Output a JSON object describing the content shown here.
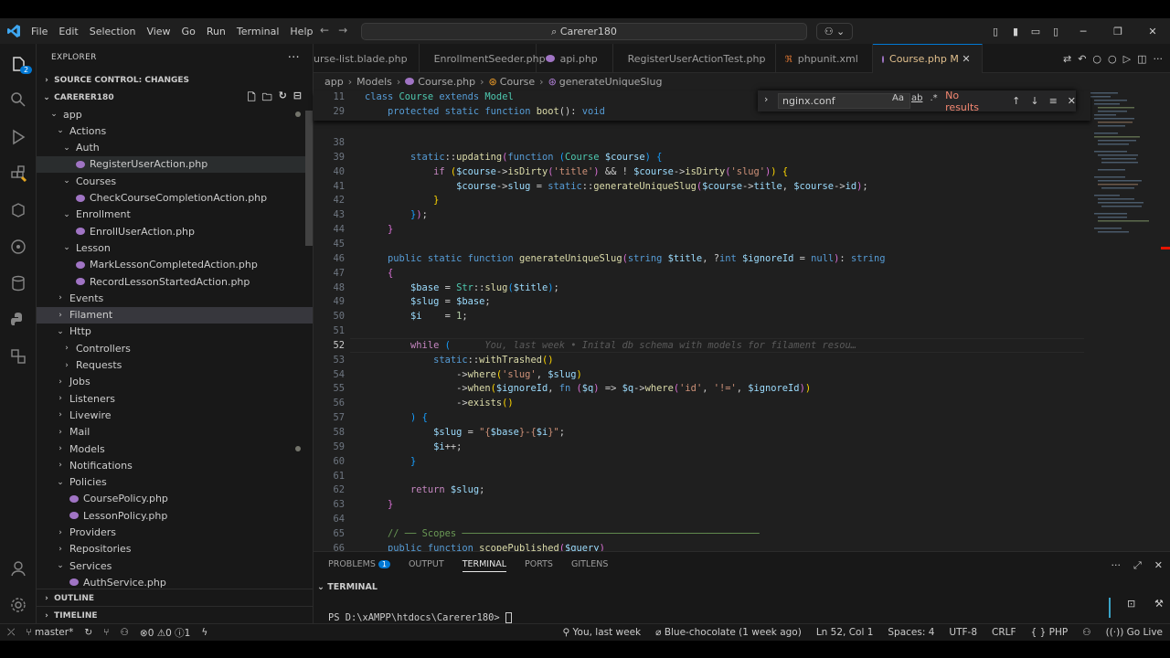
{
  "titlebar": {
    "menu": [
      "File",
      "Edit",
      "Selection",
      "View",
      "Go",
      "Run",
      "Terminal",
      "Help"
    ],
    "search": "Carerer180"
  },
  "activity": {
    "scm_badge": "2"
  },
  "explorer": {
    "header": "EXPLORER",
    "scm_section": "SOURCE CONTROL: CHANGES",
    "project": "CARERER180",
    "tree": [
      {
        "label": "app",
        "depth": 0,
        "type": "folder",
        "open": true,
        "dot": true
      },
      {
        "label": "Actions",
        "depth": 1,
        "type": "folder",
        "open": true
      },
      {
        "label": "Auth",
        "depth": 2,
        "type": "folder",
        "open": true
      },
      {
        "label": "RegisterUserAction.php",
        "depth": 3,
        "type": "file",
        "hover": true
      },
      {
        "label": "Courses",
        "depth": 2,
        "type": "folder",
        "open": true
      },
      {
        "label": "CheckCourseCompletionAction.php",
        "depth": 3,
        "type": "file"
      },
      {
        "label": "Enrollment",
        "depth": 2,
        "type": "folder",
        "open": true
      },
      {
        "label": "EnrollUserAction.php",
        "depth": 3,
        "type": "file"
      },
      {
        "label": "Lesson",
        "depth": 2,
        "type": "folder",
        "open": true
      },
      {
        "label": "MarkLessonCompletedAction.php",
        "depth": 3,
        "type": "file"
      },
      {
        "label": "RecordLessonStartedAction.php",
        "depth": 3,
        "type": "file"
      },
      {
        "label": "Events",
        "depth": 1,
        "type": "folder",
        "open": false
      },
      {
        "label": "Filament",
        "depth": 1,
        "type": "folder",
        "open": false,
        "sel": true
      },
      {
        "label": "Http",
        "depth": 1,
        "type": "folder",
        "open": true
      },
      {
        "label": "Controllers",
        "depth": 2,
        "type": "folder",
        "open": false
      },
      {
        "label": "Requests",
        "depth": 2,
        "type": "folder",
        "open": false
      },
      {
        "label": "Jobs",
        "depth": 1,
        "type": "folder",
        "open": false
      },
      {
        "label": "Listeners",
        "depth": 1,
        "type": "folder",
        "open": false
      },
      {
        "label": "Livewire",
        "depth": 1,
        "type": "folder",
        "open": false
      },
      {
        "label": "Mail",
        "depth": 1,
        "type": "folder",
        "open": false
      },
      {
        "label": "Models",
        "depth": 1,
        "type": "folder",
        "open": false,
        "dot": true
      },
      {
        "label": "Notifications",
        "depth": 1,
        "type": "folder",
        "open": false
      },
      {
        "label": "Policies",
        "depth": 1,
        "type": "folder",
        "open": true
      },
      {
        "label": "CoursePolicy.php",
        "depth": 2,
        "type": "file"
      },
      {
        "label": "LessonPolicy.php",
        "depth": 2,
        "type": "file"
      },
      {
        "label": "Providers",
        "depth": 1,
        "type": "folder",
        "open": false
      },
      {
        "label": "Repositories",
        "depth": 1,
        "type": "folder",
        "open": false
      },
      {
        "label": "Services",
        "depth": 1,
        "type": "folder",
        "open": true
      },
      {
        "label": "AuthService.php",
        "depth": 2,
        "type": "file"
      }
    ],
    "outline": "OUTLINE",
    "timeline": "TIMELINE"
  },
  "tabs": [
    {
      "label": "urse-list.blade.php",
      "icon": "none"
    },
    {
      "label": "EnrollmentSeeder.php",
      "icon": "php"
    },
    {
      "label": "api.php",
      "icon": "php"
    },
    {
      "label": "RegisterUserActionTest.php",
      "icon": "php"
    },
    {
      "label": "phpunit.xml",
      "icon": "rss"
    },
    {
      "label": "Course.php",
      "icon": "php",
      "active": true,
      "modified": "M"
    }
  ],
  "breadcrumb": [
    "app",
    "Models",
    "Course.php",
    "Course",
    "generateUniqueSlug"
  ],
  "find": {
    "value": "nginx.conf",
    "result": "No results",
    "opt_case": "Aa",
    "opt_word": "ab",
    "opt_regex": ".*"
  },
  "sticky": [
    {
      "n": "11",
      "html": "<span class='kw'>class</span> <span class='cl'>Course</span> <span class='kw'>extends</span> <span class='cl'>Model</span>"
    },
    {
      "n": "29",
      "html": "    <span class='kw'>protected</span> <span class='kw'>static</span> <span class='kw'>function</span> <span class='fn'>boot</span>(): <span class='kw'>void</span>"
    }
  ],
  "code": [
    {
      "n": "38",
      "html": ""
    },
    {
      "n": "39",
      "html": "        <span class='kw'>static</span>::<span class='fn'>updating</span><span class='br2'>(</span><span class='kw'>function</span> <span class='br3'>(</span><span class='cl'>Course</span> <span class='vr'>$course</span><span class='br3'>)</span> <span class='br3'>{</span>"
    },
    {
      "n": "40",
      "html": "            <span class='ctl'>if</span> <span class='br1'>(</span><span class='vr'>$course</span>-><span class='fn'>isDirty</span><span class='br2'>(</span><span class='st'>'title'</span><span class='br2'>)</span> && ! <span class='vr'>$course</span>-><span class='fn'>isDirty</span><span class='br2'>(</span><span class='st'>'slug'</span><span class='br2'>)</span><span class='br1'>)</span> <span class='br1'>{</span>"
    },
    {
      "n": "41",
      "html": "                <span class='vr'>$course</span>-><span class='vr'>slug</span> = <span class='kw'>static</span>::<span class='fn'>generateUniqueSlug</span><span class='br2'>(</span><span class='vr'>$course</span>-><span class='vr'>title</span>, <span class='vr'>$course</span>-><span class='vr'>id</span><span class='br2'>)</span>;"
    },
    {
      "n": "42",
      "html": "            <span class='br1'>}</span>"
    },
    {
      "n": "43",
      "html": "        <span class='br3'>}</span><span class='br2'>)</span>;"
    },
    {
      "n": "44",
      "html": "    <span class='br2'>}</span>"
    },
    {
      "n": "45",
      "html": ""
    },
    {
      "n": "46",
      "html": "    <span class='kw'>public</span> <span class='kw'>static</span> <span class='kw'>function</span> <span class='fn'>generateUniqueSlug</span><span class='br2'>(</span><span class='kw'>string</span> <span class='vr'>$title</span>, ?<span class='kw'>int</span> <span class='vr'>$ignoreId</span> = <span class='kw'>null</span><span class='br2'>)</span>: <span class='kw'>string</span>"
    },
    {
      "n": "47",
      "html": "    <span class='br2'>{</span>"
    },
    {
      "n": "48",
      "html": "        <span class='vr'>$base</span> = <span class='cl'>Str</span>::<span class='fn'>slug</span><span class='br3'>(</span><span class='vr'>$title</span><span class='br3'>)</span>;"
    },
    {
      "n": "49",
      "html": "        <span class='vr'>$slug</span> = <span class='vr'>$base</span>;"
    },
    {
      "n": "50",
      "html": "        <span class='vr'>$i</span>    = <span class='num'>1</span>;"
    },
    {
      "n": "51",
      "html": ""
    },
    {
      "n": "52",
      "html": "        <span class='ctl'>while</span> <span class='br3'>(</span>      <span class='blame'>You, last week • Inital db schema with models for filament resou…</span>",
      "cur": true
    },
    {
      "n": "53",
      "html": "            <span class='kw'>static</span>::<span class='fn'>withTrashed</span><span class='br1'>()</span>"
    },
    {
      "n": "54",
      "html": "                -><span class='fn'>where</span><span class='br1'>(</span><span class='st'>'slug'</span>, <span class='vr'>$slug</span><span class='br1'>)</span>"
    },
    {
      "n": "55",
      "html": "                -><span class='fn'>when</span><span class='br1'>(</span><span class='vr'>$ignoreId</span>, <span class='kw'>fn</span> <span class='br2'>(</span><span class='vr'>$q</span><span class='br2'>)</span> => <span class='vr'>$q</span>-><span class='fn'>where</span><span class='br2'>(</span><span class='st'>'id'</span>, <span class='st'>'!='</span>, <span class='vr'>$ignoreId</span><span class='br2'>)</span><span class='br1'>)</span>"
    },
    {
      "n": "56",
      "html": "                -><span class='fn'>exists</span><span class='br1'>()</span>"
    },
    {
      "n": "57",
      "html": "        <span class='br3'>)</span> <span class='br3'>{</span>"
    },
    {
      "n": "58",
      "html": "            <span class='vr'>$slug</span> = <span class='st'>\"{</span><span class='vr'>$base</span><span class='st'>}-{</span><span class='vr'>$i</span><span class='st'>}\"</span>;"
    },
    {
      "n": "59",
      "html": "            <span class='vr'>$i</span>++;"
    },
    {
      "n": "60",
      "html": "        <span class='br3'>}</span>"
    },
    {
      "n": "61",
      "html": ""
    },
    {
      "n": "62",
      "html": "        <span class='ctl'>return</span> <span class='vr'>$slug</span>;"
    },
    {
      "n": "63",
      "html": "    <span class='br2'>}</span>"
    },
    {
      "n": "64",
      "html": ""
    },
    {
      "n": "65",
      "html": "    <span class='cm'>// ── Scopes ────────────────────────────────────────────────────</span>"
    },
    {
      "n": "66",
      "html": "    <span class='kw'>public</span> <span class='kw'>function</span> <span class='fn'>scopePublished</span><span class='br2'>(</span><span class='vr'>$query</span><span class='br2'>)</span>"
    }
  ],
  "panel": {
    "tabs": [
      "PROBLEMS",
      "OUTPUT",
      "TERMINAL",
      "PORTS",
      "GITLENS"
    ],
    "problems_count": "1",
    "section": "TERMINAL",
    "prompt": "PS D:\\xAMPP\\htdocs\\Carerer180> "
  },
  "status": {
    "branch": "master*",
    "errors": "0",
    "warnings": "0",
    "info": "1",
    "blame": "You, last week",
    "author": "Blue-chocolate (1 week ago)",
    "position": "Ln 52, Col 1",
    "spaces": "Spaces: 4",
    "encoding": "UTF-8",
    "eol": "CRLF",
    "language": "PHP",
    "golive": "Go Live"
  }
}
